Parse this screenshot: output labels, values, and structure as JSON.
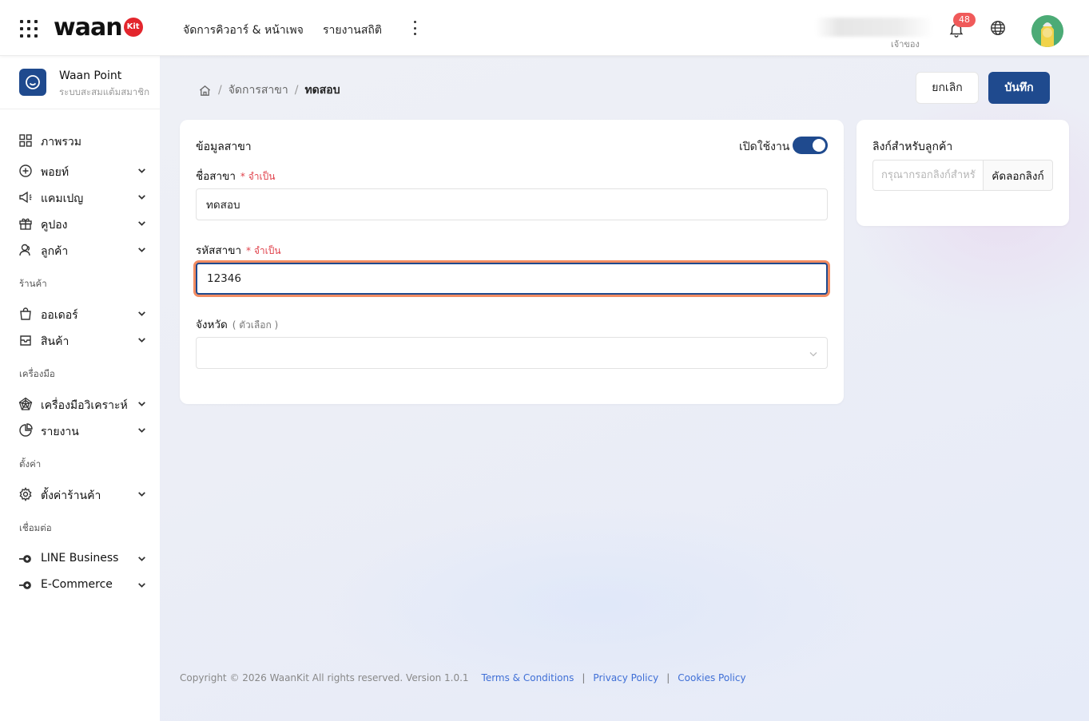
{
  "topbar": {
    "logo_text": "waan",
    "logo_badge": "Kit",
    "nav": [
      "จัดการคิวอาร์ & หน้าเพจ",
      "รายงานสถิติ"
    ],
    "user_role": "เจ้าของ",
    "notification_count": "48"
  },
  "sidebar": {
    "brand_name": "Waan Point",
    "brand_sub": "ระบบสะสมแต้มสมาชิก",
    "items": [
      {
        "label": "ภาพรวม",
        "icon": "grid-icon"
      },
      {
        "label": "พอยท์",
        "icon": "plus-circle-icon"
      },
      {
        "label": "แคมเปญ",
        "icon": "megaphone-icon"
      },
      {
        "label": "คูปอง",
        "icon": "gift-icon"
      },
      {
        "label": "ลูกค้า",
        "icon": "users-icon"
      },
      {
        "label": "ออเดอร์",
        "icon": "bag-icon"
      },
      {
        "label": "สินค้า",
        "icon": "box-icon"
      },
      {
        "label": "เครื่องมือวิเคราะห์",
        "icon": "analysis-icon"
      },
      {
        "label": "รายงาน",
        "icon": "pie-icon"
      },
      {
        "label": "ตั้งค่าร้านค้า",
        "icon": "gear-icon"
      },
      {
        "label": "LINE Business",
        "icon": "plug-icon"
      },
      {
        "label": "E-Commerce",
        "icon": "plug-icon"
      }
    ],
    "sections": {
      "shop": "ร้านค้า",
      "tools": "เครื่องมือ",
      "settings": "ตั้งค่า",
      "connect": "เชื่อมต่อ"
    }
  },
  "breadcrumb": {
    "level1": "จัดการสาขา",
    "current": "ทดสอบ"
  },
  "actions": {
    "cancel": "ยกเลิก",
    "save": "บันทึก"
  },
  "branch_form": {
    "title": "ข้อมูลสาขา",
    "toggle_label": "เปิดใช้งาน",
    "toggle_on": true,
    "name_label": "ชื่อสาขา",
    "name_required": "* จำเป็น",
    "name_value": "ทดสอบ",
    "code_label": "รหัสสาขา",
    "code_required": "* จำเป็น",
    "code_value": "12346",
    "province_label": "จังหวัด",
    "province_optional": "( ตัวเลือก )",
    "province_value": ""
  },
  "customer_link": {
    "title": "ลิงก์สำหรับลูกค้า",
    "placeholder": "กรุณากรอกลิงก์สำหรับลูกค้า",
    "copy_label": "คัดลอกลิงก์"
  },
  "footer": {
    "copyright": "Copyright © 2026 WaanKit All rights reserved. Version 1.0.1",
    "terms": "Terms & Conditions",
    "privacy": "Privacy Policy",
    "cookies": "Cookies Policy"
  }
}
